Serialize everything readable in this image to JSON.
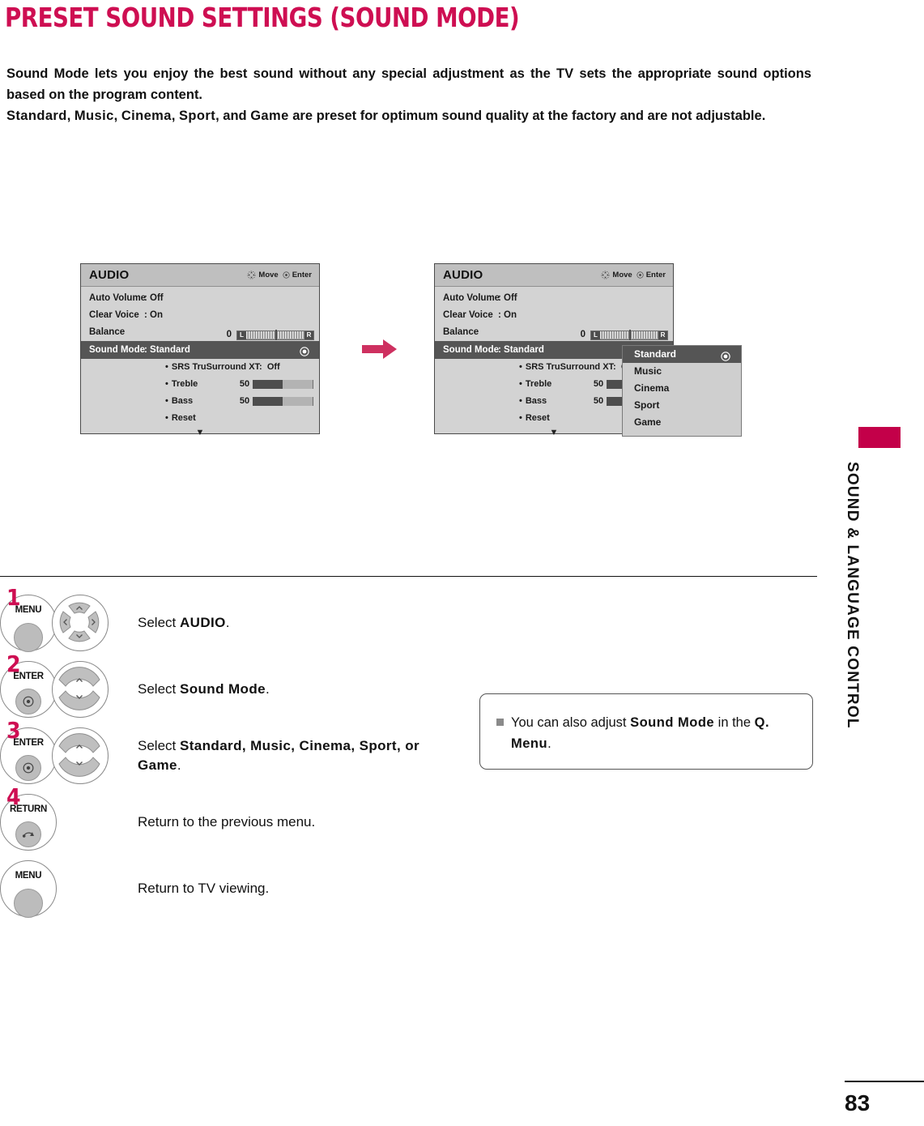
{
  "page": {
    "title": "PRESET SOUND SETTINGS (SOUND MODE)",
    "number": "83",
    "section_label": "SOUND & LANGUAGE CONTROL",
    "accent_color": "#C30049"
  },
  "intro": {
    "paragraph1": "Sound Mode lets you enjoy the best sound without any special adjustment as the TV sets the appropriate sound options based on the program content.",
    "line2_terms": [
      "Standard",
      "Music",
      "Cinema",
      "Sport",
      "Game"
    ],
    "line2_mid": ", and ",
    "line2_tail": " are preset for optimum sound quality at the factory and are not adjustable."
  },
  "osd": {
    "title": "AUDIO",
    "hint_move": "Move",
    "hint_enter": "Enter",
    "rows": [
      {
        "label": "Auto Volume",
        "value": ": Off"
      },
      {
        "label": "Clear Voice",
        "value": ": On"
      }
    ],
    "balance": {
      "label": "Balance",
      "value": "0",
      "left_cap": "L",
      "right_cap": "R"
    },
    "sound_mode": {
      "label": "Sound Mode",
      "value": ": Standard"
    },
    "sub_items": [
      {
        "name": "SRS TruSurround XT:",
        "value": "Off",
        "type": "text"
      },
      {
        "name": "Treble",
        "value": "50",
        "type": "level",
        "fill_percent": 50
      },
      {
        "name": "Bass",
        "value": "50",
        "type": "level",
        "fill_percent": 50
      },
      {
        "name": "Reset",
        "value": "",
        "type": "text"
      }
    ],
    "more_arrow": "▼"
  },
  "dropdown": {
    "items": [
      {
        "label": "Standard",
        "selected": true
      },
      {
        "label": "Music",
        "selected": false
      },
      {
        "label": "Cinema",
        "selected": false
      },
      {
        "label": "Sport",
        "selected": false
      },
      {
        "label": "Game",
        "selected": false
      }
    ]
  },
  "steps": [
    {
      "number": "1",
      "buttons": [
        {
          "label": "MENU",
          "glyph": "plain"
        },
        {
          "label": "",
          "glyph": "dpad4"
        }
      ],
      "text_prefix": "Select ",
      "text_bold": "AUDIO",
      "text_suffix": "."
    },
    {
      "number": "2",
      "buttons": [
        {
          "label": "ENTER",
          "glyph": "enter"
        },
        {
          "label": "",
          "glyph": "updown"
        }
      ],
      "text_prefix": "Select ",
      "text_bold": "Sound Mode",
      "text_suffix": "."
    },
    {
      "number": "3",
      "buttons": [
        {
          "label": "ENTER",
          "glyph": "enter"
        },
        {
          "label": "",
          "glyph": "updown"
        }
      ],
      "text_prefix": "Select ",
      "text_bold": "Standard, Music, Cinema, Sport, or Game",
      "text_suffix": "."
    },
    {
      "number": "4",
      "buttons": [
        {
          "label": "RETURN",
          "glyph": "return"
        }
      ],
      "text_prefix": "Return to the previous menu.",
      "text_bold": "",
      "text_suffix": ""
    },
    {
      "number": "",
      "buttons": [
        {
          "label": "MENU",
          "glyph": "plain"
        }
      ],
      "text_prefix": "Return to TV viewing.",
      "text_bold": "",
      "text_suffix": ""
    }
  ],
  "note": {
    "prefix": "You can also adjust ",
    "bold1": "Sound Mode",
    "mid": " in the ",
    "bold2": "Q. Menu",
    "suffix": "."
  }
}
